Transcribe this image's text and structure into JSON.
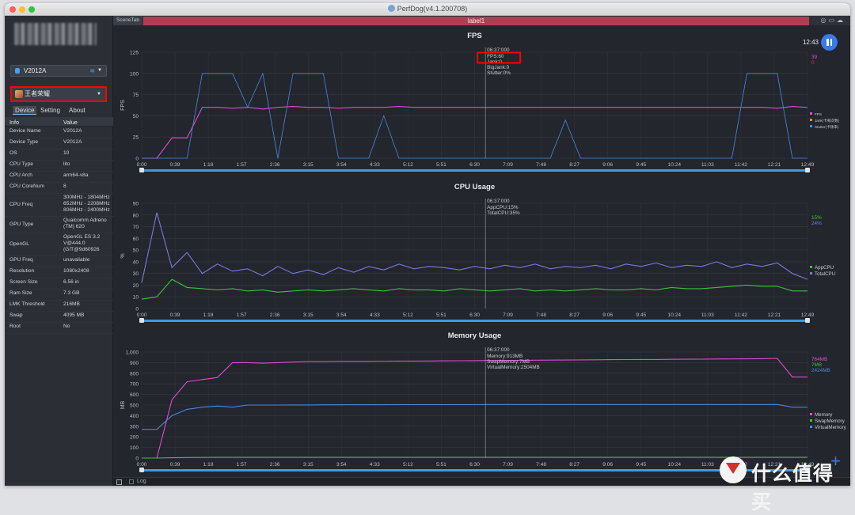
{
  "window": {
    "title": "PerfDog(v4.1.200708)"
  },
  "sidebar": {
    "device_select": "V2012A",
    "app_select": "王者荣耀",
    "tabs": [
      "Device",
      "Setting",
      "About"
    ],
    "table_header": {
      "info": "Info",
      "value": "Value"
    },
    "rows": [
      {
        "k": "Device Name",
        "v": "V2012A"
      },
      {
        "k": "Device Type",
        "v": "V2012A"
      },
      {
        "k": "OS",
        "v": "10"
      },
      {
        "k": "CPU Type",
        "v": "lito"
      },
      {
        "k": "CPU Arch",
        "v": "arm64-v8a"
      },
      {
        "k": "CPU CoreNum",
        "v": "8"
      },
      {
        "k": "CPU Freq",
        "v": "300MHz - 1804MHz\n652MHz - 2208MHz\n806MHz - 2400MHz"
      },
      {
        "k": "GPU Type",
        "v": "Qualcomm Adreno\n(TM) 620"
      },
      {
        "k": "OpenGL",
        "v": "OpenGL ES 3.2\nV@444.0\n(GIT@9d60926"
      },
      {
        "k": "GPU Freq",
        "v": "unavailable"
      },
      {
        "k": "Resolution",
        "v": "1080x2408"
      },
      {
        "k": "Screen Size",
        "v": "6.56 in"
      },
      {
        "k": "Ram Size",
        "v": "7.3 GB"
      },
      {
        "k": "LMK Threshold",
        "v": "216MB"
      },
      {
        "k": "Swap",
        "v": "4095 MB"
      },
      {
        "k": "Root",
        "v": "No"
      }
    ]
  },
  "main": {
    "scene_tab": "SceneTab",
    "label_tab": "label1",
    "time": "12:43",
    "log_label": "Log"
  },
  "watermark": {
    "text": "什么值得买"
  },
  "colors": {
    "accent": "#3a79e7",
    "label_bar": "#b13d54",
    "fps": "#e04bd0",
    "total_cpu": "#7a78e0",
    "app_cpu": "#3fbf3f",
    "virtual_memory": "#4a88e0",
    "swap_memory": "#3fbf3f",
    "highlight": "#ff0000"
  },
  "chart_data": [
    {
      "type": "line",
      "title": "FPS",
      "ylabel": "FPS",
      "ylim": [
        0,
        125
      ],
      "yticks": [
        0,
        25,
        50,
        75,
        100,
        125
      ],
      "x_ticks": [
        "0:00",
        "0:39",
        "1:18",
        "1:57",
        "2:36",
        "3:15",
        "3:54",
        "4:33",
        "5:12",
        "5:51",
        "6:30",
        "7:09",
        "7:48",
        "8:27",
        "9:06",
        "9:45",
        "10:24",
        "11:03",
        "11:42",
        "12:21",
        "12:49"
      ],
      "cursor": {
        "x": "6:37",
        "label": "06:37:000",
        "lines": [
          "FPS:60",
          "Jank:0",
          "BigJank:0",
          "Stutter:0%"
        ]
      },
      "current_values": [
        "39",
        "0"
      ],
      "legend": [
        "FPS",
        "Jank(卡顿次数)",
        "Stutter(卡顿率)"
      ],
      "series": [
        {
          "name": "FPS",
          "values": [
            0,
            0,
            24,
            24,
            60,
            60,
            59,
            60,
            58,
            60,
            61,
            60,
            60,
            59,
            60,
            60,
            60,
            61,
            60,
            60,
            60,
            60,
            60,
            60,
            60,
            60,
            60,
            60,
            60,
            60,
            60,
            60,
            60,
            60,
            60,
            60,
            60,
            60,
            60,
            60,
            60,
            60,
            59,
            61,
            60
          ]
        },
        {
          "name": "Stutter(卡顿率)",
          "values": [
            0,
            0,
            0,
            0,
            100,
            100,
            100,
            60,
            100,
            0,
            100,
            100,
            100,
            0,
            0,
            0,
            50,
            0,
            0,
            0,
            0,
            0,
            0,
            0,
            0,
            0,
            0,
            0,
            45,
            0,
            0,
            0,
            0,
            0,
            0,
            0,
            0,
            0,
            0,
            0,
            100,
            100,
            100,
            0,
            0
          ]
        }
      ]
    },
    {
      "type": "line",
      "title": "CPU Usage",
      "ylabel": "%",
      "ylim": [
        0,
        90
      ],
      "yticks": [
        0,
        10,
        20,
        30,
        40,
        50,
        60,
        70,
        80,
        90
      ],
      "cursor": {
        "x": "6:37",
        "label": "06:37:000",
        "lines": [
          "AppCPU:15%",
          "TotalCPU:35%"
        ]
      },
      "current_values": [
        "15%",
        "24%"
      ],
      "legend": [
        "AppCPU",
        "TotalCPU"
      ],
      "series": [
        {
          "name": "TotalCPU",
          "values": [
            22,
            82,
            35,
            48,
            30,
            38,
            32,
            34,
            28,
            36,
            30,
            33,
            29,
            35,
            31,
            36,
            33,
            38,
            34,
            36,
            35,
            33,
            36,
            34,
            37,
            35,
            38,
            34,
            36,
            35,
            37,
            34,
            38,
            36,
            39,
            35,
            37,
            36,
            40,
            35,
            38,
            36,
            39,
            30,
            25
          ]
        },
        {
          "name": "AppCPU",
          "values": [
            8,
            10,
            25,
            18,
            17,
            16,
            17,
            15,
            16,
            14,
            15,
            16,
            15,
            16,
            17,
            16,
            15,
            17,
            16,
            16,
            15,
            17,
            16,
            15,
            16,
            17,
            15,
            16,
            15,
            16,
            17,
            16,
            16,
            17,
            16,
            18,
            17,
            17,
            18,
            19,
            20,
            19,
            19,
            15,
            15
          ]
        }
      ]
    },
    {
      "type": "line",
      "title": "Memory Usage",
      "ylabel": "MB",
      "ylim": [
        0,
        1000
      ],
      "yticks": [
        "0",
        "100",
        "200",
        "300",
        "400",
        "500",
        "600",
        "700",
        "800",
        "900",
        "1,000"
      ],
      "cursor": {
        "x": "6:37",
        "label": "06:37:000",
        "lines": [
          "Memory:913MB",
          "SwapMemory:7MB",
          "VirtualMemory:2504MB"
        ]
      },
      "current_values": [
        "764MB",
        "7MB",
        "2424MB"
      ],
      "legend": [
        "Memory",
        "SwapMemory",
        "VirtualMemory"
      ],
      "series": [
        {
          "name": "Memory",
          "values": [
            0,
            0,
            550,
            720,
            740,
            760,
            900,
            900,
            895,
            900,
            905,
            910,
            910,
            912,
            913,
            913,
            914,
            915,
            915,
            916,
            917,
            918,
            919,
            920,
            921,
            922,
            923,
            924,
            925,
            926,
            927,
            928,
            929,
            930,
            930,
            931,
            932,
            933,
            934,
            935,
            936,
            937,
            940,
            764,
            764
          ]
        },
        {
          "name": "SwapMemory",
          "values": [
            0,
            0,
            3,
            5,
            6,
            7,
            7,
            7,
            7,
            7,
            7,
            7,
            7,
            7,
            7,
            7,
            7,
            7,
            7,
            7,
            7,
            7,
            7,
            7,
            7,
            7,
            7,
            7,
            7,
            7,
            7,
            7,
            7,
            7,
            7,
            7,
            7,
            7,
            7,
            7,
            7,
            7,
            7,
            7,
            7
          ]
        },
        {
          "name": "VirtualMemory",
          "values": [
            270,
            270,
            400,
            460,
            480,
            490,
            480,
            500,
            500,
            500,
            501,
            501,
            502,
            502,
            503,
            503,
            503,
            504,
            504,
            504,
            504,
            504,
            504,
            505,
            505,
            505,
            505,
            505,
            505,
            505,
            505,
            505,
            505,
            505,
            505,
            505,
            505,
            505,
            505,
            505,
            505,
            505,
            505,
            480,
            480
          ]
        }
      ]
    }
  ]
}
